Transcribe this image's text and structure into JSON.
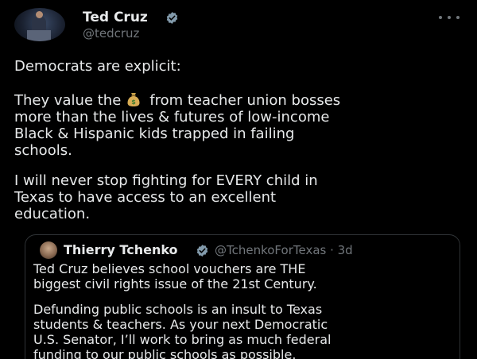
{
  "tweet": {
    "author": {
      "name": "Ted Cruz",
      "handle": "@tedcruz",
      "verified": true
    },
    "paragraph1": "Democrats are explicit:",
    "paragraph2": {
      "line1_before": "They value the",
      "line1_emoji": "money-bag",
      "line1_after": "from teacher union bosses",
      "line2": "more than the lives & futures of low-income",
      "line3": "Black & Hispanic kids trapped in failing",
      "line4": "schools."
    },
    "paragraph3": {
      "line1": "I will never stop fighting for EVERY child in",
      "line2": "Texas to have access to an excellent",
      "line3": "education."
    }
  },
  "quoted_tweet": {
    "author": {
      "name": "Thierry Tchenko",
      "handle_and_time": "@TchenkoForTexas · 3d",
      "verified": true
    },
    "paragraph1": {
      "line1": "Ted Cruz believes school vouchers are THE",
      "line2": "biggest civil rights issue of the 21st Century."
    },
    "paragraph2": {
      "line1": "Defunding public schools is an insult to Texas",
      "line2": "students & teachers. As your next Democratic",
      "line3": "U.S. Senator, I’ll work to bring as much federal",
      "line4": "funding to our public schools as possible."
    }
  },
  "colors": {
    "background": "#000000",
    "text_primary": "#e7e9ea",
    "text_secondary": "#71767b",
    "verified_badge": "#829aab",
    "quote_border": "#2f3336"
  }
}
